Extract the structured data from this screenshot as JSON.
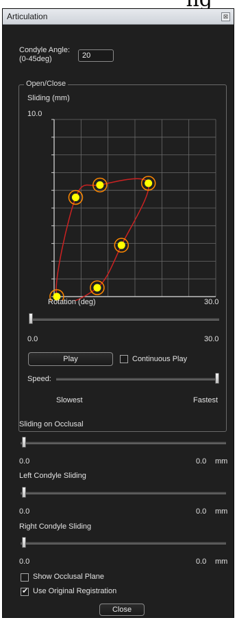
{
  "window": {
    "title": "Articulation",
    "close_glyph": "⊠"
  },
  "condyle_angle": {
    "label_line1": "Condyle Angle:",
    "label_line2": "(0-45deg)",
    "value": "20"
  },
  "open_close": {
    "group_label": "Open/Close",
    "chart_ylabel": "Sliding (mm)",
    "chart_ymax_label": "10.0",
    "chart_xlabel": "Rotation (deg)",
    "chart_xmax_label": "30.0",
    "rotation_slider": {
      "min_label": "0.0",
      "max_label": "30.0",
      "value": 0
    },
    "play_button": "Play",
    "continuous_play": {
      "label": "Continuous Play",
      "checked": false
    },
    "speed": {
      "label": "Speed:",
      "slowest": "Slowest",
      "fastest": "Fastest",
      "value": 1.0
    }
  },
  "chart_data": {
    "type": "line",
    "x_range": [
      0,
      30
    ],
    "y_range": [
      0,
      10
    ],
    "grid": true,
    "control_points": [
      {
        "x": 0.5,
        "y": 0.0
      },
      {
        "x": 4.0,
        "y": 5.6
      },
      {
        "x": 8.5,
        "y": 6.3
      },
      {
        "x": 17.5,
        "y": 6.4
      },
      {
        "x": 12.5,
        "y": 2.9
      },
      {
        "x": 8.0,
        "y": 0.5
      }
    ],
    "colors": {
      "curve": "#cc2222",
      "point_fill": "#ffff00",
      "point_ring": "#ff8800",
      "grid": "#6a6a6a"
    }
  },
  "sliding_on_occlusal": {
    "label": "Sliding on Occlusal",
    "min_label": "0.0",
    "value_label": "0.0",
    "unit": "mm",
    "value": 0
  },
  "left_condyle_sliding": {
    "label": "Left Condyle Sliding",
    "min_label": "0.0",
    "value_label": "0.0",
    "unit": "mm",
    "value": 0
  },
  "right_condyle_sliding": {
    "label": "Right Condyle Sliding",
    "min_label": "0.0",
    "value_label": "0.0",
    "unit": "mm",
    "value": 0
  },
  "show_occlusal_plane": {
    "label": "Show Occlusal Plane",
    "checked": false
  },
  "use_original_registration": {
    "label": "Use Original Registration",
    "checked": true
  },
  "close_button": "Close"
}
